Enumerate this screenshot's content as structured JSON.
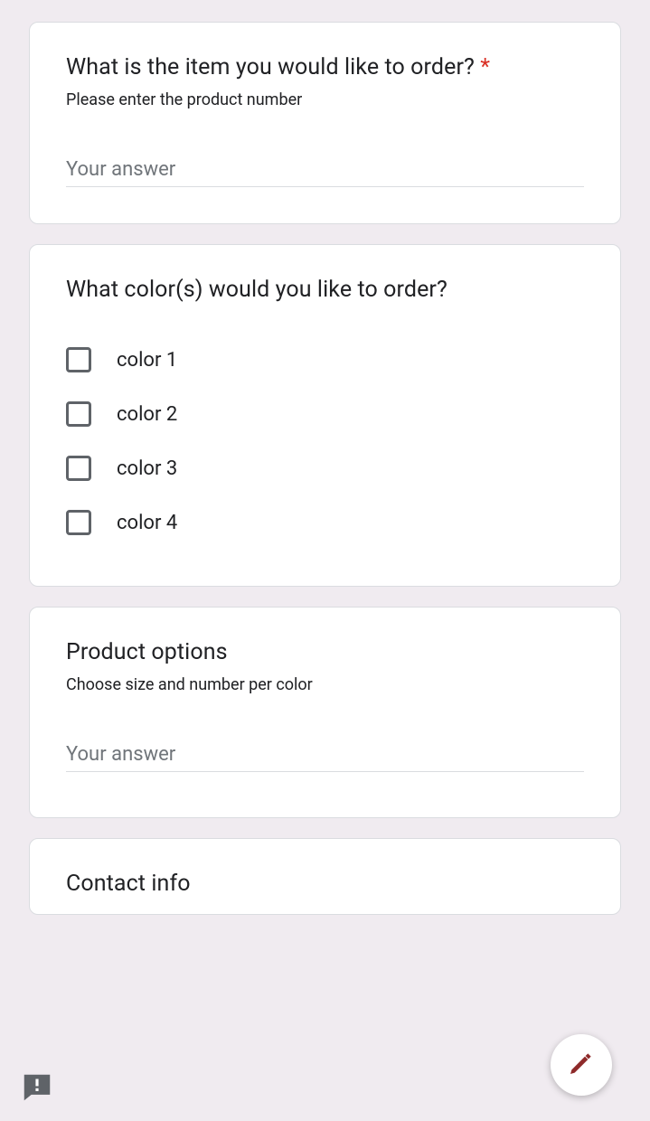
{
  "questions": [
    {
      "title": "What is the item you would like to order?",
      "required": true,
      "description": "Please enter the product number",
      "placeholder": "Your answer",
      "type": "short_answer"
    },
    {
      "title": "What color(s) would you like to order?",
      "type": "checkbox",
      "options": [
        "color 1",
        "color 2",
        "color 3",
        "color 4"
      ]
    },
    {
      "title": "Product options",
      "description": "Choose size and number per color",
      "placeholder": "Your answer",
      "type": "short_answer"
    },
    {
      "title": "Contact info",
      "type": "section"
    }
  ],
  "required_marker": "*"
}
